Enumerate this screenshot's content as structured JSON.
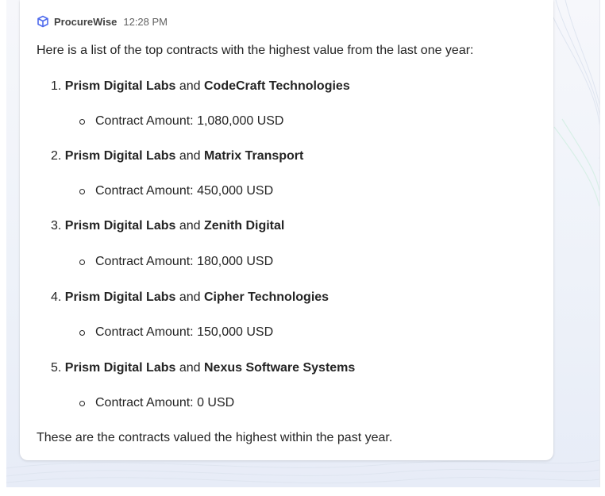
{
  "message": {
    "sender": "ProcureWise",
    "time": "12:28 PM",
    "intro": "Here is a list of the top contracts with the highest value from the last one year:",
    "connector": "and",
    "items": [
      {
        "number": "1.",
        "party_a": "Prism Digital Labs",
        "party_b": "CodeCraft Technologies",
        "detail": "Contract Amount: 1,080,000 USD"
      },
      {
        "number": "2.",
        "party_a": "Prism Digital Labs",
        "party_b": "Matrix Transport",
        "detail": "Contract Amount: 450,000 USD"
      },
      {
        "number": "3.",
        "party_a": "Prism Digital Labs",
        "party_b": "Zenith Digital",
        "detail": "Contract Amount: 180,000 USD"
      },
      {
        "number": "4.",
        "party_a": "Prism Digital Labs",
        "party_b": "Cipher Technologies",
        "detail": "Contract Amount: 150,000 USD"
      },
      {
        "number": "5.",
        "party_a": "Prism Digital Labs",
        "party_b": "Nexus Software Systems",
        "detail": "Contract Amount: 0 USD"
      }
    ],
    "outro": "These are the contracts valued the highest within the past year."
  },
  "colors": {
    "accent": "#4f6bed",
    "text": "#242424"
  },
  "icons": {
    "bot": "cube-icon",
    "bullet": "hollow-circle-bullet"
  }
}
